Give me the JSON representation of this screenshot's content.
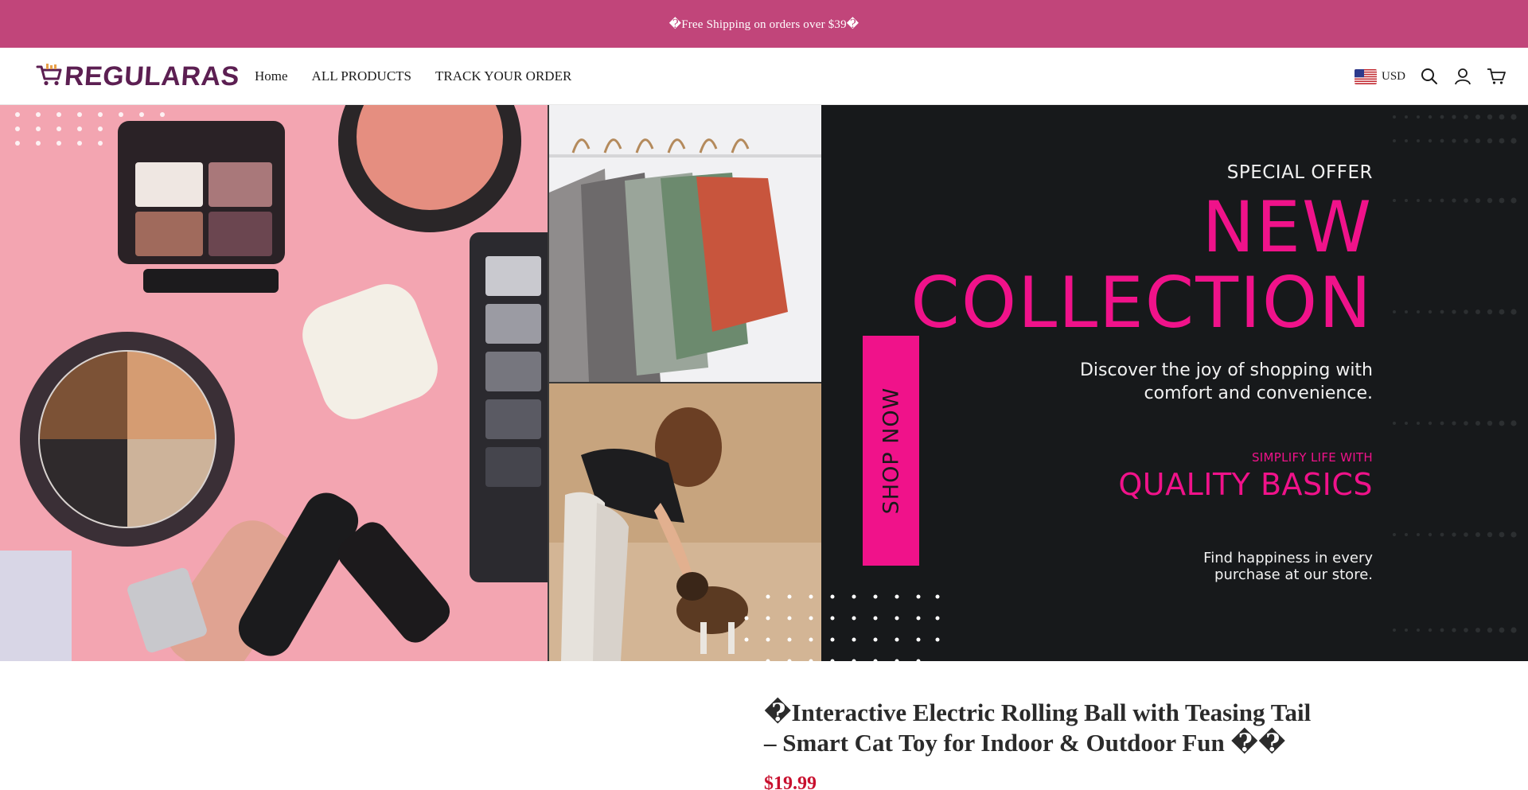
{
  "announcement": {
    "text": "�Free Shipping on orders over $39�"
  },
  "header": {
    "logo_text": "REGULARAS",
    "nav": [
      {
        "label": "Home"
      },
      {
        "label": "ALL PRODUCTS"
      },
      {
        "label": "TRACK YOUR ORDER"
      }
    ],
    "currency": "USD",
    "icons": [
      "us-flag-icon",
      "search-icon",
      "account-icon",
      "cart-icon"
    ]
  },
  "hero": {
    "special_offer": "SPECIAL OFFER",
    "headline_line1": "NEW",
    "headline_line2": "COLLECTION",
    "discover_line1": "Discover the joy of shopping with",
    "discover_line2": "comfort and convenience.",
    "simplify": "SIMPLIFY LIFE WITH",
    "quality": "QUALITY BASICS",
    "find_line1": "Find happiness in every",
    "find_line2": "purchase at our store.",
    "shop_now": "SHOP NOW"
  },
  "product": {
    "title_line1": "�Interactive Electric Rolling Ball with Teasing Tail",
    "title_line2": "– Smart Cat Toy for Indoor & Outdoor Fun ��",
    "price": "$19.99"
  },
  "colors": {
    "announcement_bg": "#c1457a",
    "logo": "#5c1f52",
    "accent_pink": "#f0128a",
    "hero_dark": "#17191b",
    "price": "#c8102e"
  }
}
